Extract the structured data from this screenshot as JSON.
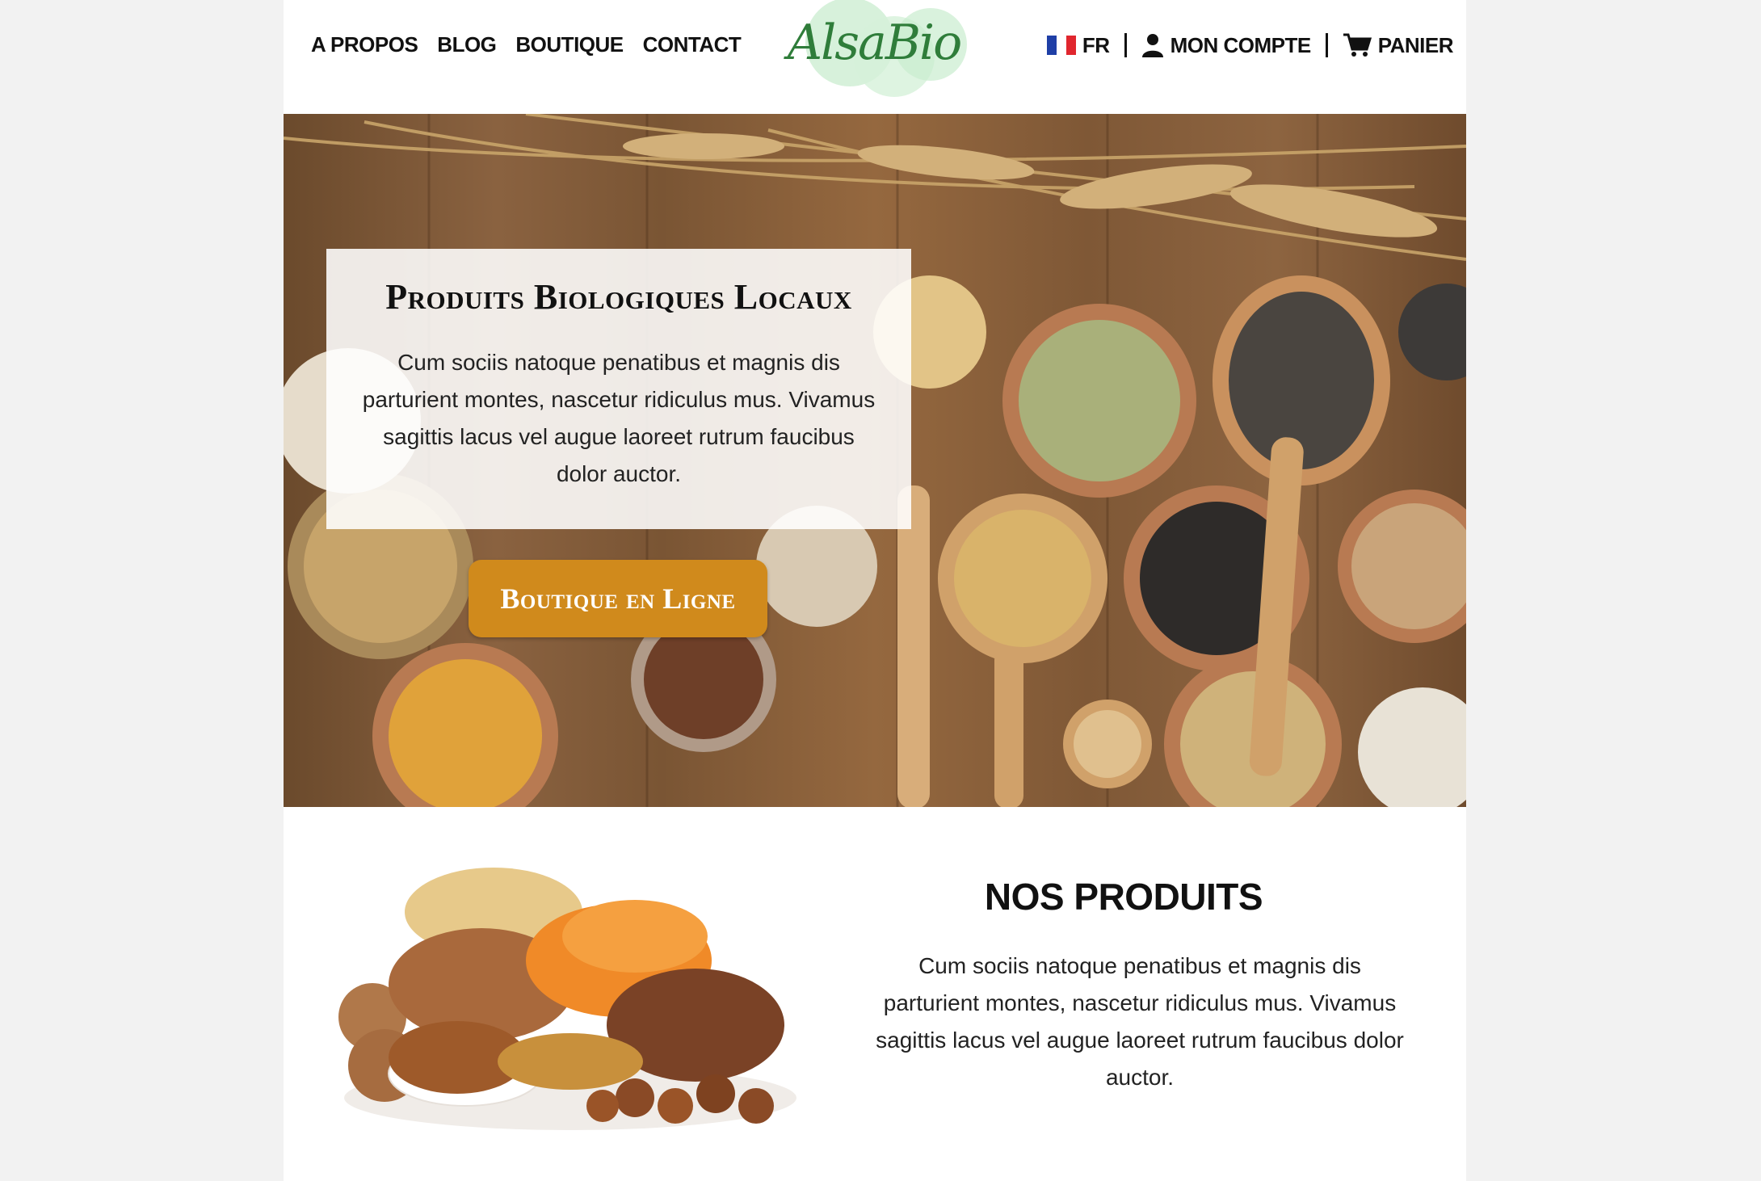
{
  "nav": {
    "links": [
      "A PROPOS",
      "BLOG",
      "BOUTIQUE",
      "CONTACT"
    ],
    "logo": "AlsaBio",
    "language": "FR",
    "account": "MON COMPTE",
    "cart": "PANIER"
  },
  "hero": {
    "title": "Produits Biologiques Locaux",
    "text": "Cum sociis natoque penatibus et magnis dis parturient montes, nascetur ridiculus mus. Vivamus sagittis lacus vel augue laoreet rutrum faucibus dolor auctor.",
    "button": "Boutique en Ligne"
  },
  "products": {
    "title": "NOS PRODUITS",
    "text": "Cum sociis natoque penatibus et magnis dis parturient montes, nascetur ridiculus mus. Vivamus sagittis lacus vel augue laoreet rutrum faucibus dolor auctor."
  },
  "colors": {
    "accent": "#d08a1c",
    "logo_green": "#2f7d3a",
    "logo_bg": "#c9eccf",
    "wood": "#8a6240"
  },
  "icons": [
    "france-flag-icon",
    "user-icon",
    "cart-icon"
  ]
}
